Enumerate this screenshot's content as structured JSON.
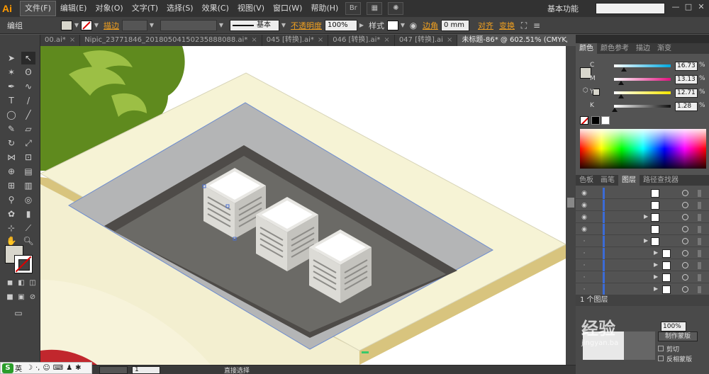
{
  "app": {
    "logo": "Ai",
    "workspace": "基本功能",
    "search_placeholder": ""
  },
  "menu": [
    "文件(F)",
    "编辑(E)",
    "对象(O)",
    "文字(T)",
    "选择(S)",
    "效果(C)",
    "视图(V)",
    "窗口(W)",
    "帮助(H)"
  ],
  "control": {
    "object_type": "编组",
    "stroke_label": "描边",
    "brush_label": "基本",
    "opacity_label": "不透明度",
    "opacity_value": "100%",
    "style_label": "样式",
    "corner_label": "边角",
    "corner_value": "0 mm",
    "align_label": "对齐",
    "transform_label": "变换"
  },
  "tabs": [
    {
      "label": "00.ai*",
      "active": false
    },
    {
      "label": "Nipic_23771846_20180504150235888088.ai*",
      "active": false
    },
    {
      "label": "045 [转换].ai*",
      "active": false
    },
    {
      "label": "046 [转换].ai*",
      "active": false
    },
    {
      "label": "047 [转换].ai",
      "active": false
    },
    {
      "label": "未标题-86* @ 602.51% (CMYK/预览)",
      "active": true
    }
  ],
  "color_panel": {
    "tabs": [
      "颜色",
      "颜色参考",
      "描边",
      "渐变"
    ],
    "sliders": [
      {
        "letter": "C",
        "value": "16.73",
        "knob": 0.17,
        "gradient": "linear-gradient(to right,#fff,#00a8e0)"
      },
      {
        "letter": "M",
        "value": "13.13",
        "knob": 0.13,
        "gradient": "linear-gradient(to right,#fff,#e0127f)"
      },
      {
        "letter": "Y",
        "value": "12.71",
        "knob": 0.13,
        "gradient": "linear-gradient(to right,#fff,#f4e500)"
      },
      {
        "letter": "K",
        "value": "1.28",
        "knob": 0.01,
        "gradient": "linear-gradient(to right,#fff,#111)"
      }
    ],
    "pct": "%"
  },
  "layers_panel": {
    "tabs": [
      "色板",
      "画笔",
      "图层",
      "路径查找器"
    ],
    "footer": "1 个图层"
  },
  "bottom_panel": {
    "opacity_value": "100%",
    "make_mask": "制作蒙版",
    "clip": "剪切",
    "invert_mask": "反相蒙版",
    "brand": "经验",
    "brand_latin": "jingyan.ba"
  },
  "status": {
    "zoom": "",
    "page": "1",
    "tool": "直接选择"
  },
  "ime": {
    "lang": "英"
  },
  "colors": {
    "accent_orange": "#f0a020",
    "wall_top": "#f6f3d5",
    "wall_side": "#d8c47e",
    "roof_inner": "#b4b5b6",
    "roof_floor": "#6b6a66",
    "tree_dark": "#5f8a1e",
    "tree_light": "#9cbf45"
  }
}
